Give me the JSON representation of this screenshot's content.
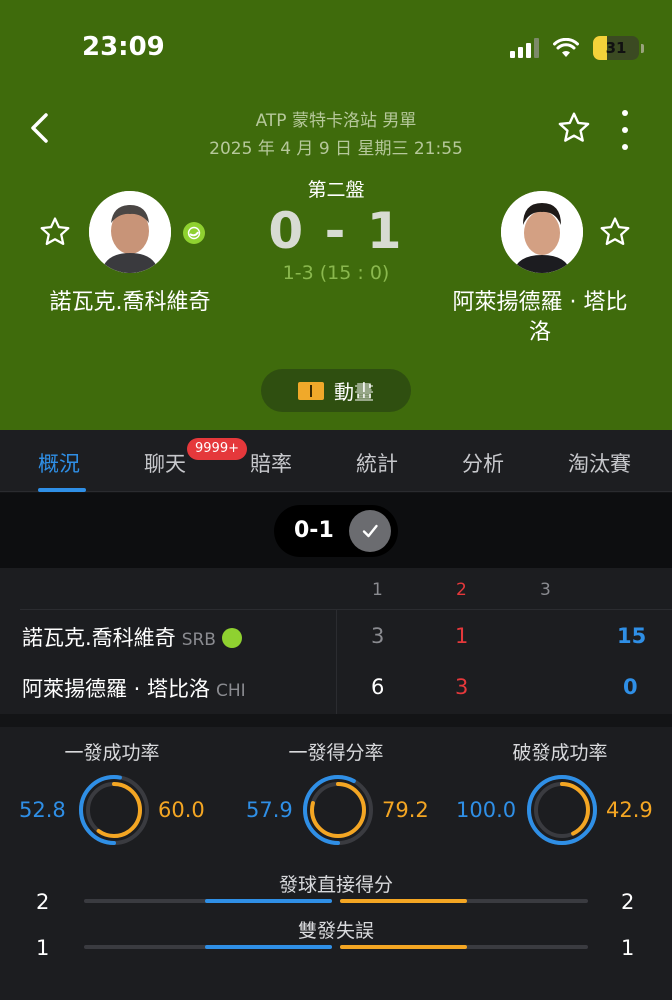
{
  "status_bar": {
    "time": "23:09",
    "battery": "31"
  },
  "match": {
    "tournament": "ATP 蒙特卡洛站 男單",
    "datetime": "2025 年 4 月 9 日  星期三  21:55",
    "current_set": "第二盤",
    "score": "0 - 1",
    "game_score": "1-3 (15 : 0)",
    "animation_label": "動畫"
  },
  "players": {
    "home": {
      "name": "諾瓦克.喬科維奇",
      "short_name": "諾瓦克.喬科維奇",
      "nationality": "SRB",
      "serving": true
    },
    "away": {
      "name_line1": "阿萊揚德羅 · 塔比",
      "name_line2": "洛",
      "short_name": "阿萊揚德羅 · 塔比洛",
      "nationality": "CHI"
    }
  },
  "tabs": [
    {
      "label": "概況",
      "active": true
    },
    {
      "label": "聊天",
      "badge": "9999+"
    },
    {
      "label": "賠率"
    },
    {
      "label": "統計"
    },
    {
      "label": "分析"
    },
    {
      "label": "淘汰賽"
    }
  ],
  "set_selector": {
    "label": "0-1"
  },
  "score_table": {
    "set_headers": [
      "1",
      "2",
      "3"
    ],
    "home": {
      "sets": [
        "3",
        "1"
      ],
      "points": "15"
    },
    "away": {
      "sets": [
        "6",
        "3"
      ],
      "points": "0"
    }
  },
  "stats": {
    "rings": [
      {
        "title": "一發成功率",
        "home": "52.8",
        "away": "60.0",
        "home_pct": 52.8,
        "away_pct": 60.0
      },
      {
        "title": "一發得分率",
        "home": "57.9",
        "away": "79.2",
        "home_pct": 57.9,
        "away_pct": 79.2
      },
      {
        "title": "破發成功率",
        "home": "100.0",
        "away": "42.9",
        "home_pct": 100.0,
        "away_pct": 42.9
      }
    ],
    "bars": [
      {
        "title": "發球直接得分",
        "home": "2",
        "away": "2"
      },
      {
        "title": "雙發失誤",
        "home": "1",
        "away": "1"
      }
    ]
  },
  "colors": {
    "header_bg": "#3f6b0c",
    "home": "#2f8fe6",
    "away": "#f4a623",
    "accent_red": "#e5383b"
  }
}
